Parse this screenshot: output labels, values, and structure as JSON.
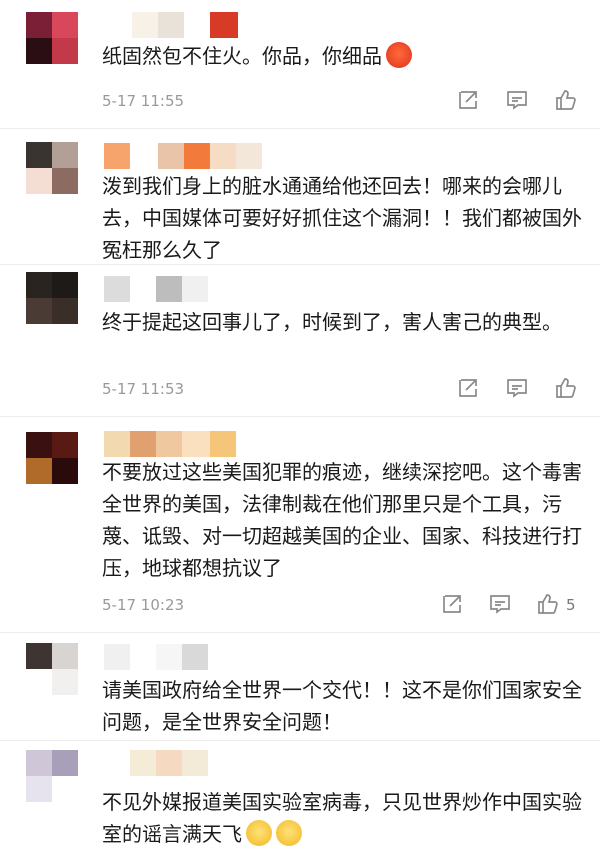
{
  "comments": [
    {
      "text": "纸固然包不住火。你品，你细品",
      "emoji": "angry-face-emoji",
      "time": "5-17 11:55",
      "likes": "",
      "avatar_colors": [
        "#7a1f35",
        "#d8485a",
        "#2b0e14",
        "#c23a4a"
      ],
      "name_colors": [
        "#ffffff",
        "#f7f1e8",
        "#e8e2d8",
        "#ffffff",
        "#d83a28"
      ]
    },
    {
      "text": "泼到我们身上的脏水通通给他还回去！哪来的会哪儿去，中国媒体可要好好抓住这个漏洞！！我们都被国外冤枉那么久了",
      "time": "",
      "avatar_colors": [
        "#3a3430",
        "#b29f95",
        "#f4ddd2",
        "#8c6c62"
      ],
      "name_colors": [
        "#f6a46b",
        "#ffffff",
        "#e9c4a8",
        "#f27a3a",
        "#f7dcc5",
        "#f2e7d8"
      ]
    },
    {
      "text": "终于提起这回事儿了，时候到了，害人害己的典型。",
      "time": "5-17 11:53",
      "likes": "",
      "avatar_colors": [
        "#2a2420",
        "#1e1a18",
        "#4a3c34",
        "#3a2e28"
      ],
      "name_colors": [
        "#dcdcdc",
        "#ffffff",
        "#bdbdbd",
        "#f0f0f0"
      ]
    },
    {
      "text": "不要放过这些美国犯罪的痕迹，继续深挖吧。这个毒害全世界的美国，法律制裁在他们那里只是个工具，污蔑、诋毁、对一切超越美国的企业、国家、科技进行打压，地球都想抗议了",
      "time": "5-17 10:23",
      "likes": "5",
      "avatar_colors": [
        "#3a1010",
        "#5a1a14",
        "#b06a2a",
        "#2a0a0a"
      ],
      "name_colors": [
        "#f3d9b0",
        "#e0a070",
        "#f0c8a0",
        "#fbe0c0",
        "#f5c57a"
      ]
    },
    {
      "text": "请美国政府给全世界一个交代！！这不是你们国家安全问题，是全世界安全问题！",
      "time": "",
      "avatar_colors": [
        "#3e3432",
        "#d8d4d2",
        "#ffffff",
        "#f2f0ef"
      ],
      "name_colors": [
        "#f0f0f0",
        "#ffffff",
        "#f6f6f6",
        "#d9d9d9"
      ]
    },
    {
      "text": "不见外媒报道美国实验室病毒，只见世界炒作中国实验室的谣言满天飞",
      "emoji": "shy-face-emoji",
      "time": "",
      "avatar_colors": [
        "#cfc7d8",
        "#a8a0b8",
        "#e6e2ee",
        "#ffffff"
      ],
      "name_colors": [
        "#ffffff",
        "#f5ecd8",
        "#f5d9c0",
        "#f4ead8"
      ]
    }
  ],
  "actions": {
    "forward_icon": "share-icon",
    "comment_icon": "comment-icon",
    "like_icon": "thumbs-up-icon"
  },
  "colors": {
    "text": "#1a1a1a",
    "meta": "#9a9a9a",
    "icon": "#8a8a8a",
    "divider": "#ececec"
  }
}
